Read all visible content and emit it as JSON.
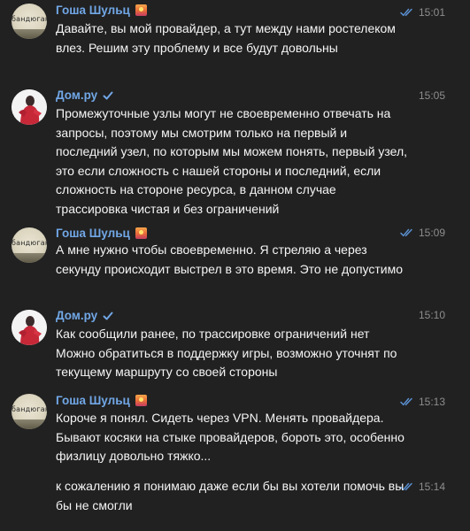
{
  "messages": [
    {
      "author": "Гоша Шульц",
      "author_badge": "sunset-emoji",
      "avatar_text": "бандюган",
      "time": "15:01",
      "read": true,
      "text": "Давайте, вы мой провайдер, а тут между нами ростелеком влез. Решим эту проблему и все будут довольны"
    },
    {
      "author": "Дом.ру",
      "verified": true,
      "time": "15:05",
      "text": "Промежуточные узлы могут не своевременно отвечать на запросы, поэтому мы смотрим только на первый и последний узел, по которым мы можем понять, первый узел, это если сложность с нашей стороны и последний, если сложность на стороне ресурса, в данном случае трассировка чистая и без ограничений"
    },
    {
      "author": "Гоша Шульц",
      "author_badge": "sunset-emoji",
      "avatar_text": "бандюган",
      "time": "15:09",
      "read": true,
      "text": "А мне нужно чтобы своевременно. Я стреляю а через секунду происходит выстрел в это время. Это не допустимо"
    },
    {
      "author": "Дом.ру",
      "verified": true,
      "time": "15:10",
      "text": "Как сообщили ранее, по трассировке ограничений нет\nМожно обратиться в поддержку игры, возможно уточнят по текущему маршруту со своей стороны"
    },
    {
      "author": "Гоша Шульц",
      "author_badge": "sunset-emoji",
      "avatar_text": "бандюган",
      "time": "15:13",
      "read": true,
      "text": "Короче я понял. Сидеть через VPN. Менять провайдера. Бывают косяки на стыке провайдеров, бороть это, особенно физлицу довольно тяжко..."
    },
    {
      "continuation": true,
      "time": "15:14",
      "read": true,
      "text": "к сожалению я понимаю даже если бы вы хотели помочь вы бы не смогли"
    }
  ],
  "colors": {
    "background": "#212121",
    "author": "#71a7e6",
    "text": "#f5f5f5",
    "time": "#8d8d8d",
    "read_check": "#5a8fd0"
  }
}
